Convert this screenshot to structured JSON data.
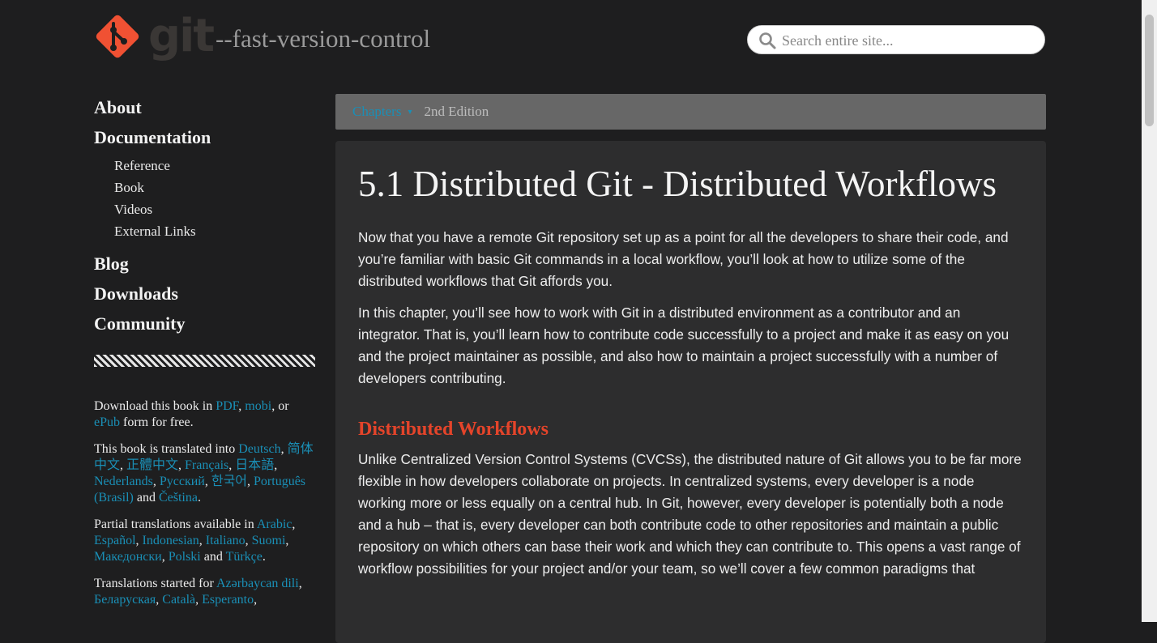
{
  "header": {
    "wordmark": "git",
    "tagline": "--fast-version-control",
    "search_placeholder": "Search entire site..."
  },
  "sidebar": {
    "about": "About",
    "documentation": "Documentation",
    "doc_items": [
      "Reference",
      "Book",
      "Videos",
      "External Links"
    ],
    "blog": "Blog",
    "downloads": "Downloads",
    "community": "Community"
  },
  "book_info": {
    "download_pre": "Download this book in ",
    "pdf": "PDF",
    "sep1": ", ",
    "mobi": "mobi",
    "or": ", or ",
    "epub": "ePub",
    "download_post": " form for free.",
    "translated_pre": "This book is translated into ",
    "translated_langs": [
      "Deutsch",
      "简体中文",
      "正體中文",
      "Français",
      "日本語",
      "Nederlands",
      "Русский",
      "한국어",
      "Português (Brasil)",
      "Čeština"
    ],
    "translated_post": ".",
    "partial_pre": "Partial translations available in ",
    "partial_langs": [
      "Arabic",
      "Español",
      "Indonesian",
      "Italiano",
      "Suomi",
      "Македонски",
      "Polski",
      "Türkçe"
    ],
    "partial_post": ".",
    "started_pre": "Translations started for ",
    "started_langs": [
      "Azərbaycan dili",
      "Беларуская",
      "Català",
      "Esperanto"
    ],
    "and": "and"
  },
  "chapters_bar": {
    "chapters": "Chapters",
    "caret": "▾",
    "edition": "2nd Edition"
  },
  "content": {
    "title": "5.1 Distributed Git - Distributed Workflows",
    "p1": "Now that you have a remote Git repository set up as a point for all the developers to share their code, and you’re familiar with basic Git commands in a local workflow, you’ll look at how to utilize some of the distributed workflows that Git affords you.",
    "p2": "In this chapter, you’ll see how to work with Git in a distributed environment as a contributor and an integrator. That is, you’ll learn how to contribute code successfully to a project and make it as easy on you and the project maintainer as possible, and also how to maintain a project successfully with a number of developers contributing.",
    "h2": "Distributed Workflows",
    "p3": "Unlike Centralized Version Control Systems (CVCSs), the distributed nature of Git allows you to be far more flexible in how developers collaborate on projects. In centralized systems, every developer is a node working more or less equally on a central hub. In Git, however, every developer is potentially both a node and a hub – that is, every developer can both contribute code to other repositories and maintain a public repository on which others can base their work and which they can contribute to. This opens a vast range of workflow possibilities for your project and/or your team, so we’ll cover a few common paradigms that"
  },
  "colors": {
    "background": "#1e1e1f",
    "panel": "#2d2d2e",
    "link": "#1a8fb6",
    "heading_accent": "#e4442a",
    "logo": "#f05133"
  }
}
